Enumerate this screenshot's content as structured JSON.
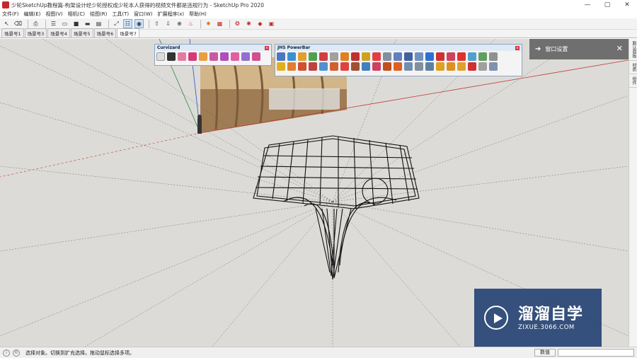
{
  "window": {
    "title": "少轮SketchUp教程篇-构架设计经少轮授权成少轮本人获得的视频文件都是违规行为 - SketchUp Pro 2020",
    "controls": [
      "—",
      "▢",
      "✕"
    ]
  },
  "menu": [
    "文件(F)",
    "编辑(E)",
    "视图(V)",
    "相机(C)",
    "绘图(R)",
    "工具(T)",
    "窗口(W)",
    "扩展程序(x)",
    "帮助(H)"
  ],
  "toolbar": {
    "icons": [
      "select-arrow-icon",
      "eraser-icon",
      "print-icon",
      "outliner-icon",
      "folder-icon",
      "box-icon",
      "rect-icon",
      "rect-2-icon",
      "line-icon",
      "layer-icon",
      "camera-icon",
      "pushpull-icon",
      "tape-icon",
      "orbit-icon",
      "pan-icon",
      "zoom-icon",
      "gear-icon",
      "grid-icon",
      "ruby-icon",
      "ruby2-icon",
      "extension-icon",
      "video-icon"
    ]
  },
  "scenes": {
    "tabs": [
      "场景号1",
      "场景号3",
      "场景号4",
      "场景号5",
      "场景号6",
      "场景号7"
    ],
    "active_index": 5
  },
  "curviloft": {
    "title": "Curvizard"
  },
  "powerbar": {
    "title": "JHS PowerBar"
  },
  "window_panel": {
    "title": "窗口设置",
    "close": "✕",
    "arrow": "➔"
  },
  "tray": [
    "默认面板",
    "材质",
    "组件"
  ],
  "status": {
    "message": "选择对象。切换到扩充选择。拖动鼠标选择多项。",
    "measurement_label": "数值"
  },
  "watermark": {
    "name": "溜溜自学",
    "url": "ZIXUE.3066.COM"
  },
  "colors": {
    "viewport_bg": "#dcdbd8",
    "axis_red": "#c0392b",
    "axis_green": "#2e8b3a",
    "axis_blue": "#2b4fc6",
    "watermark_bg": "#1e3c6e",
    "panel_bg": "#6f6f6f"
  }
}
